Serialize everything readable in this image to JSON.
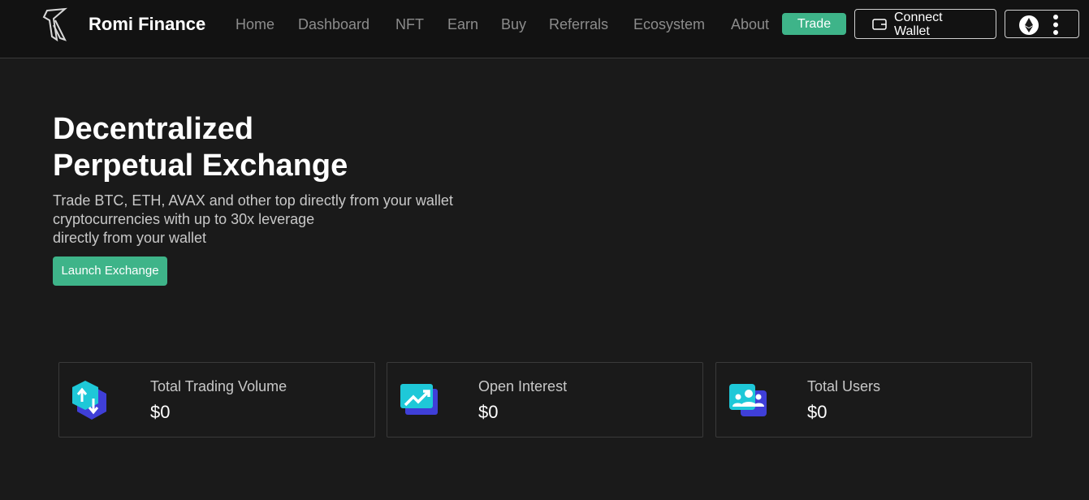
{
  "header": {
    "brand": "Romi Finance",
    "nav": [
      {
        "label": "Home"
      },
      {
        "label": "Dashboard"
      },
      {
        "label": "NFT"
      },
      {
        "label": "Earn"
      },
      {
        "label": "Buy"
      },
      {
        "label": "Referrals"
      },
      {
        "label": "Ecosystem"
      },
      {
        "label": "About"
      }
    ],
    "trade_label": "Trade",
    "connect_label": "Connect Wallet"
  },
  "hero": {
    "title_line1": "Decentralized",
    "title_line2": "Perpetual Exchange",
    "sub_line1": "Trade BTC, ETH, AVAX and other top directly from your wallet",
    "sub_line2": "cryptocurrencies with up to 30x leverage",
    "sub_line3": "directly from your wallet",
    "launch_label": "Launch Exchange"
  },
  "stats": [
    {
      "label": "Total Trading Volume",
      "value": "$0",
      "icon": "trading-volume-icon"
    },
    {
      "label": "Open Interest",
      "value": "$0",
      "icon": "open-interest-icon"
    },
    {
      "label": "Total Users",
      "value": "$0",
      "icon": "total-users-icon"
    }
  ],
  "colors": {
    "accent": "#3eb489",
    "background": "#1a1a1a",
    "header_bg": "#121212",
    "icon_cyan": "#1ec8d8",
    "icon_blue": "#3f3fd8"
  }
}
